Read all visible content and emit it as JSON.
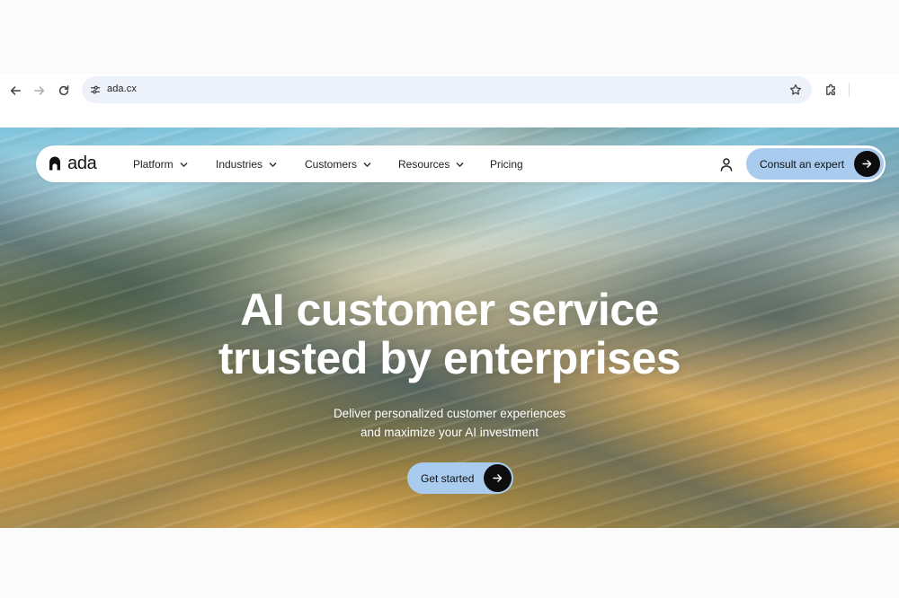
{
  "browser": {
    "url": "ada.cx",
    "icons": {
      "back": "arrow-left-icon",
      "forward": "arrow-right-icon",
      "reload": "reload-icon",
      "site_info": "tune-icon",
      "bookmark": "star-icon",
      "extensions": "puzzle-icon"
    }
  },
  "site": {
    "logo_text": "ada",
    "nav": {
      "items": [
        {
          "label": "Platform",
          "has_dropdown": true
        },
        {
          "label": "Industries",
          "has_dropdown": true
        },
        {
          "label": "Customers",
          "has_dropdown": true
        },
        {
          "label": "Resources",
          "has_dropdown": true
        },
        {
          "label": "Pricing",
          "has_dropdown": false
        }
      ],
      "consult_label": "Consult an expert"
    },
    "hero": {
      "headline_line1": "AI customer service",
      "headline_line2": "trusted by enterprises",
      "subtext_line1": "Deliver personalized customer experiences",
      "subtext_line2": "and maximize your AI investment",
      "cta_label": "Get started"
    },
    "colors": {
      "button_bg": "#a9cbee",
      "arrow_circle": "#0d0d0d",
      "headline": "#ffffff"
    }
  }
}
